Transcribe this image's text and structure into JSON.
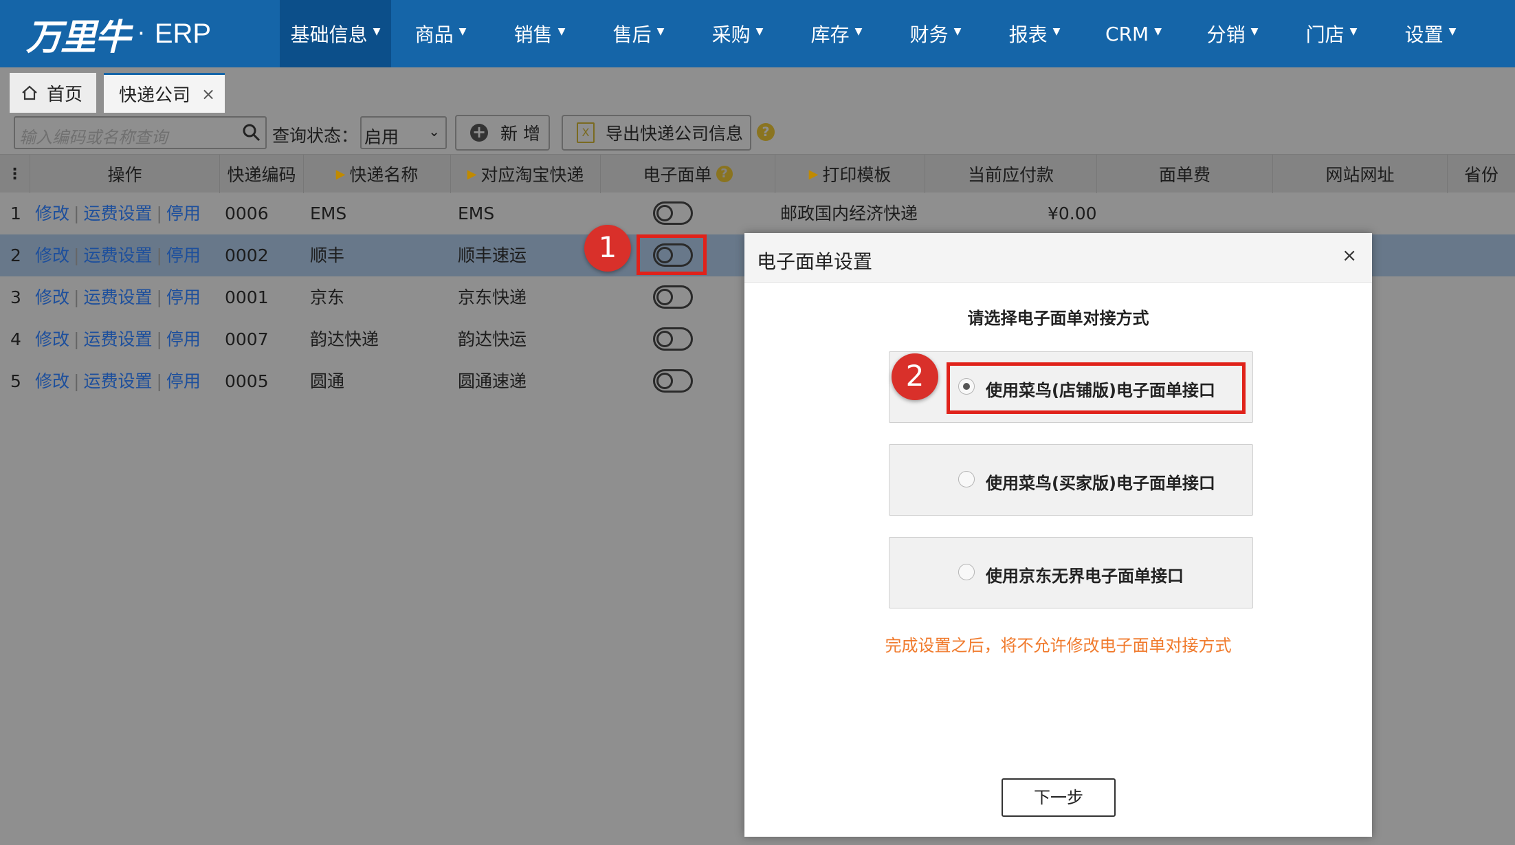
{
  "brand": {
    "logo_text": "万里牛",
    "dot": "·",
    "product": "ERP"
  },
  "nav": [
    {
      "label": "基础信息"
    },
    {
      "label": "商品"
    },
    {
      "label": "销售"
    },
    {
      "label": "售后"
    },
    {
      "label": "采购"
    },
    {
      "label": "库存"
    },
    {
      "label": "财务"
    },
    {
      "label": "报表"
    },
    {
      "label": "CRM"
    },
    {
      "label": "分销"
    },
    {
      "label": "门店"
    },
    {
      "label": "设置"
    }
  ],
  "tabs": {
    "home": "首页",
    "current": "快递公司",
    "close": "×"
  },
  "toolbar": {
    "search_placeholder": "输入编码或名称查询",
    "status_label": "查询状态：",
    "status_value": "启用",
    "add_label": "新 增",
    "export_label": "导出快递公司信息",
    "help": "?"
  },
  "table": {
    "headers": {
      "ops": "操作",
      "code": "快递编码",
      "name": "快递名称",
      "taobao": "对应淘宝快递",
      "eform": "电子面单",
      "template": "打印模板",
      "payable": "当前应付款",
      "fee": "面单费",
      "site": "网站网址",
      "province": "省份"
    },
    "actions": {
      "edit": "修改",
      "freight": "运费设置",
      "disable": "停用",
      "sep": "|"
    },
    "rows": [
      {
        "no": "1",
        "code": "0006",
        "name": "EMS",
        "taobao": "EMS",
        "eform_on": false,
        "template": "邮政国内经济快递",
        "payable": "¥0.00"
      },
      {
        "no": "2",
        "code": "0002",
        "name": "顺丰",
        "taobao": "顺丰速运",
        "eform_on": false,
        "template": "",
        "payable": ""
      },
      {
        "no": "3",
        "code": "0001",
        "name": "京东",
        "taobao": "京东快递",
        "eform_on": false,
        "template": "",
        "payable": ""
      },
      {
        "no": "4",
        "code": "0007",
        "name": "韵达快递",
        "taobao": "韵达快运",
        "eform_on": false,
        "template": "",
        "payable": ""
      },
      {
        "no": "5",
        "code": "0005",
        "name": "圆通",
        "taobao": "圆通速递",
        "eform_on": false,
        "template": "",
        "payable": ""
      }
    ],
    "selected_row": 2
  },
  "annotations": {
    "step1": "1",
    "step2": "2"
  },
  "modal": {
    "title": "电子面单设置",
    "close": "×",
    "prompt": "请选择电子面单对接方式",
    "options": [
      {
        "label": "使用菜鸟(店铺版)电子面单接口",
        "selected": true
      },
      {
        "label": "使用菜鸟(买家版)电子面单接口",
        "selected": false
      },
      {
        "label": "使用京东无界电子面单接口",
        "selected": false
      }
    ],
    "warning": "完成设置之后，将不允许修改电子面单对接方式",
    "next": "下一步"
  },
  "colors": {
    "nav_bg": "#1565a8",
    "nav_active": "#0c4f8a",
    "link": "#1d4f9c",
    "annotation_red": "#e0221a",
    "warning": "#f07a2c"
  }
}
